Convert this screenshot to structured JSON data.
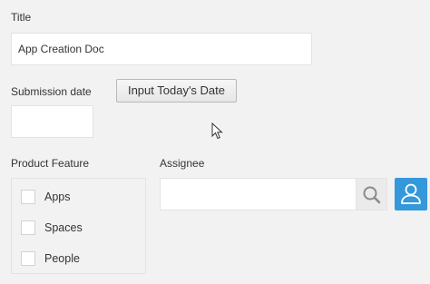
{
  "title_field": {
    "label": "Title",
    "value": "App Creation Doc"
  },
  "submission_date_field": {
    "label": "Submission date",
    "value": "",
    "button_label": "Input Today's Date"
  },
  "product_feature_field": {
    "label": "Product Feature",
    "options": [
      {
        "label": "Apps",
        "checked": false
      },
      {
        "label": "Spaces",
        "checked": false
      },
      {
        "label": "People",
        "checked": false
      }
    ]
  },
  "assignee_field": {
    "label": "Assignee",
    "value": "",
    "search_icon": "search-icon",
    "user_icon": "user-icon"
  },
  "colors": {
    "background": "#f2f2f2",
    "accent": "#3498db",
    "border": "#e3e3e3"
  }
}
